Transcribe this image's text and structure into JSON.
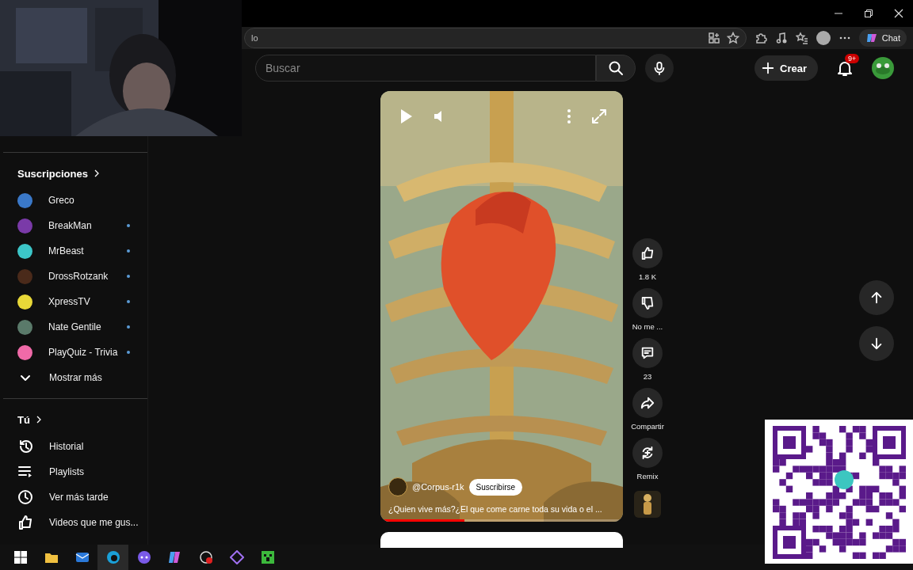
{
  "browser": {
    "address_text": "lo",
    "chat_label": "Chat"
  },
  "header": {
    "search": {
      "placeholder": "Buscar"
    },
    "create_label": "Crear",
    "notification_badge": "9+"
  },
  "sidebar": {
    "subscriptions_title": "Suscripciones",
    "channels": [
      {
        "name": "Greco",
        "color": "#3a78c8",
        "new_content": false
      },
      {
        "name": "BreakMan",
        "color": "#7a3aa8",
        "new_content": true
      },
      {
        "name": "MrBeast",
        "color": "#3cc6c8",
        "new_content": true
      },
      {
        "name": "DrossRotzank",
        "color": "#4a2a1a",
        "new_content": true
      },
      {
        "name": "XpressTV",
        "color": "#e8d838",
        "new_content": true
      },
      {
        "name": "Nate Gentile",
        "color": "#5a7a6a",
        "new_content": true
      },
      {
        "name": "PlayQuiz - Trivia",
        "color": "#f06aa8",
        "new_content": true
      }
    ],
    "show_more": "Mostrar más",
    "you_title": "Tú",
    "you_items": [
      {
        "kind": "history",
        "label": "Historial"
      },
      {
        "kind": "playlists",
        "label": "Playlists"
      },
      {
        "kind": "watch_later",
        "label": "Ver más tarde"
      },
      {
        "kind": "liked",
        "label": "Videos que me gus..."
      }
    ]
  },
  "short": {
    "channel": "@Corpus-r1k",
    "subscribe_label": "Suscribirse",
    "title": "¿Quien vive más?¿El que come carne toda su vida o el ...",
    "progress": {
      "level": 0.34
    },
    "actions": [
      {
        "kind": "like",
        "label": "1.8 K"
      },
      {
        "kind": "dislike",
        "label": "No me ..."
      },
      {
        "kind": "comment",
        "label": "23"
      },
      {
        "kind": "share",
        "label": "Compartir"
      },
      {
        "kind": "remix",
        "label": "Remix"
      }
    ]
  },
  "taskbar": {
    "apps": [
      {
        "kind": "start",
        "selected": false
      },
      {
        "kind": "files",
        "selected": false
      },
      {
        "kind": "mail",
        "selected": false
      },
      {
        "kind": "browser",
        "selected": true
      },
      {
        "kind": "chat",
        "selected": false
      },
      {
        "kind": "copilot",
        "selected": false
      },
      {
        "kind": "recorder",
        "selected": false
      },
      {
        "kind": "editor",
        "selected": false
      },
      {
        "kind": "game",
        "selected": false
      }
    ]
  }
}
